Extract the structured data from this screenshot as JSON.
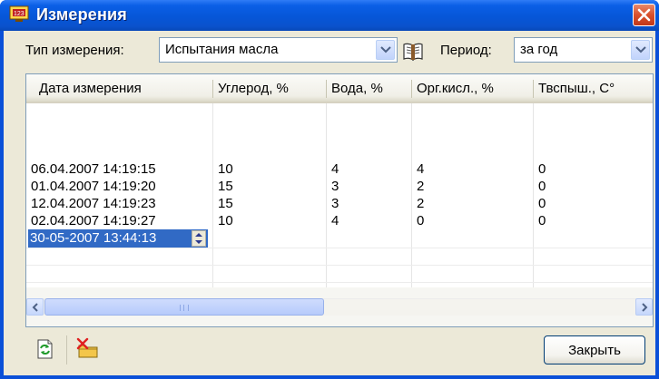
{
  "window": {
    "title": "Измерения"
  },
  "filters": {
    "type_label": "Тип измерения:",
    "type_value": "Испытания масла",
    "period_label": "Период:",
    "period_value": "за год"
  },
  "table": {
    "columns": [
      "Дата измерения",
      "Углерод, %",
      "Вода, %",
      "Орг.кисл., %",
      "Твспыш., С°"
    ],
    "rows": [
      [
        "06.04.2007 14:19:15",
        "10",
        "4",
        "4",
        "0"
      ],
      [
        "01.04.2007 14:19:20",
        "15",
        "3",
        "2",
        "0"
      ],
      [
        "12.04.2007 14:19:23",
        "15",
        "3",
        "2",
        "0"
      ],
      [
        "02.04.2007 14:19:27",
        "10",
        "4",
        "0",
        "0"
      ]
    ],
    "editing_value": "30-05-2007 13:44:13"
  },
  "footer": {
    "close_label": "Закрыть"
  },
  "icons": {
    "title": "measurement-monitor-icon",
    "dictionary": "book-icon",
    "refresh": "refresh-icon",
    "delete": "delete-folder-icon"
  },
  "colors": {
    "titlebar": "#0656d8",
    "selection": "#316ac5",
    "dialog": "#ece9d8"
  }
}
